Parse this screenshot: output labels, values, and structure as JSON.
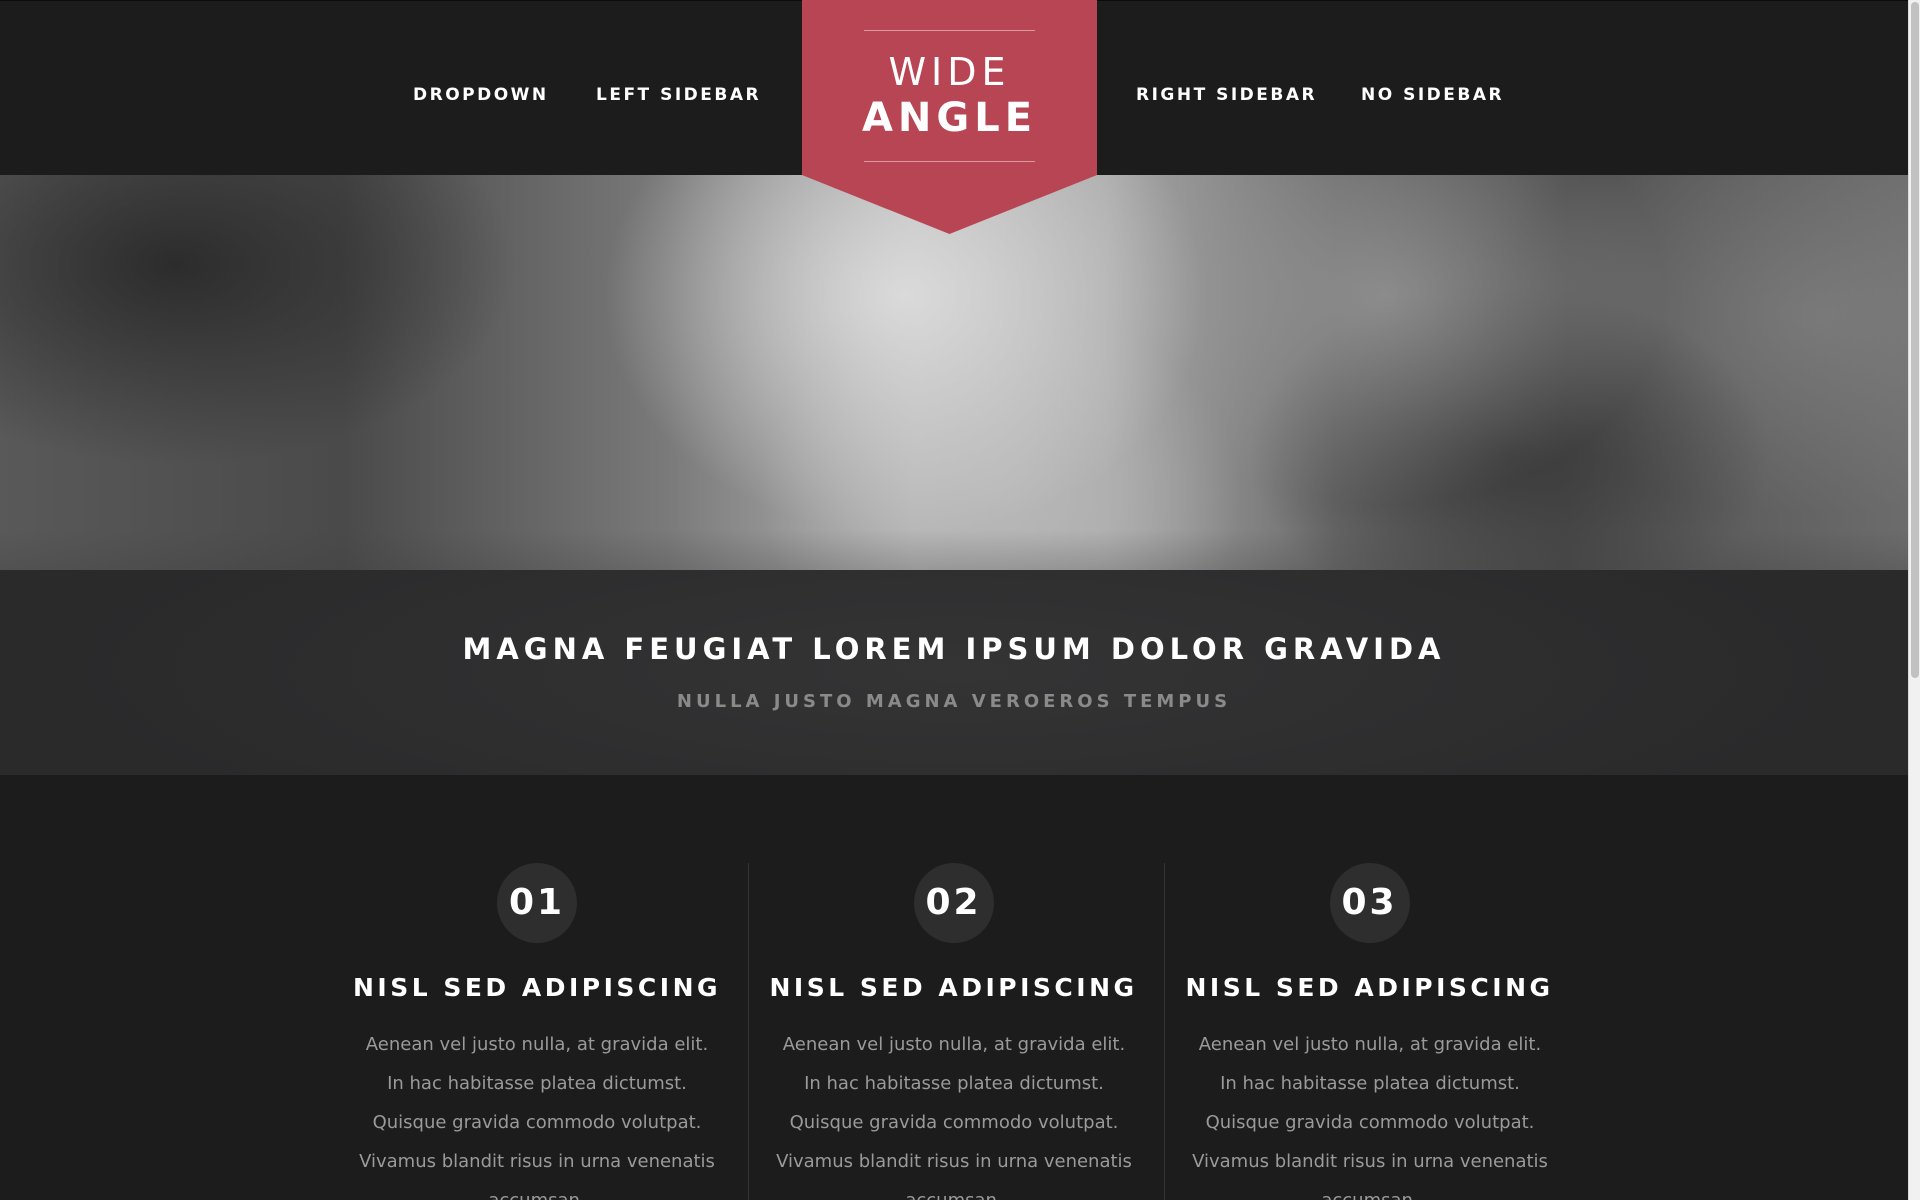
{
  "nav": {
    "left": [
      "DROPDOWN",
      "LEFT SIDEBAR"
    ],
    "right": [
      "RIGHT SIDEBAR",
      "NO SIDEBAR"
    ]
  },
  "logo": {
    "top": "WIDE",
    "bottom": "ANGLE",
    "color": "#b84553"
  },
  "banner": {
    "title": "MAGNA FEUGIAT LOREM IPSUM DOLOR GRAVIDA",
    "subtitle": "NULLA JUSTO MAGNA VEROEROS TEMPUS"
  },
  "features": [
    {
      "number": "01",
      "title": "NISL SED ADIPISCING",
      "text": "Aenean vel justo nulla, at gravida elit. In hac habitasse platea dictumst. Quisque gravida commodo volutpat. Vivamus blandit risus in urna venenatis accumsan."
    },
    {
      "number": "02",
      "title": "NISL SED ADIPISCING",
      "text": "Aenean vel justo nulla, at gravida elit. In hac habitasse platea dictumst. Quisque gravida commodo volutpat. Vivamus blandit risus in urna venenatis accumsan."
    },
    {
      "number": "03",
      "title": "NISL SED ADIPISCING",
      "text": "Aenean vel justo nulla, at gravida elit. In hac habitasse platea dictumst. Quisque gravida commodo volutpat. Vivamus blandit risus in urna venenatis accumsan."
    }
  ]
}
